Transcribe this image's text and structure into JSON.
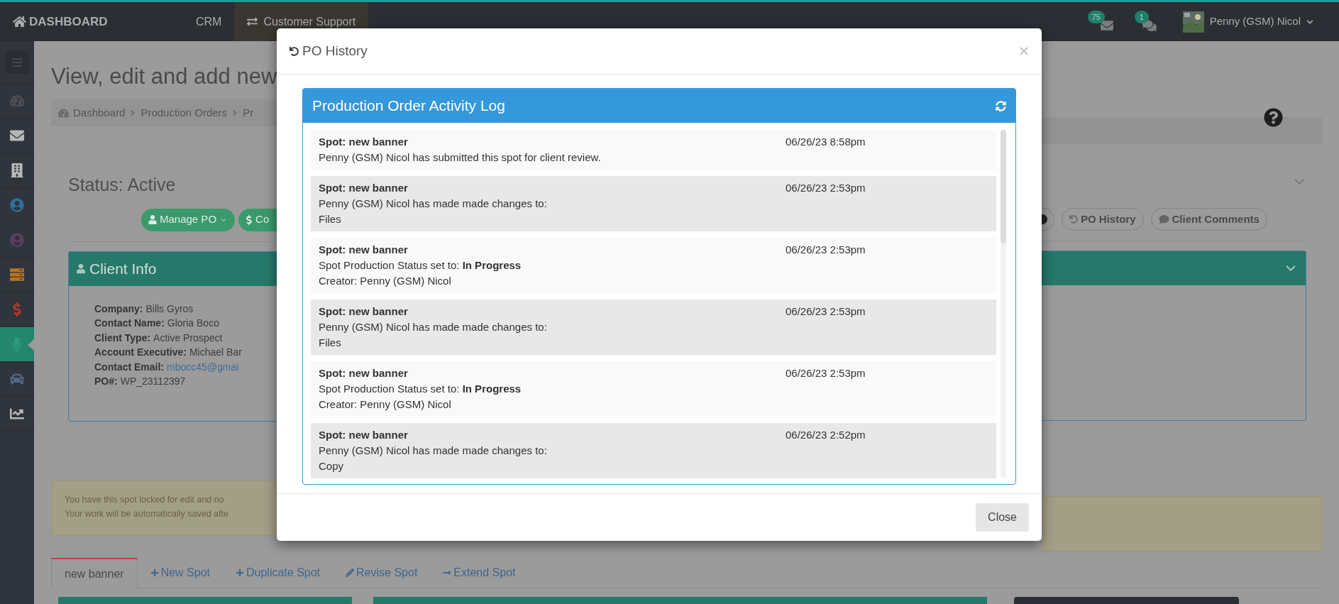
{
  "top_bar": {
    "brand": "DASHBOARD",
    "nav": [
      {
        "label": "CRM",
        "selected": false
      },
      {
        "label": "Customer Support",
        "selected": true
      }
    ],
    "mail_badge": "75",
    "chat_badge": "1",
    "user": "Penny (GSM) Nicol"
  },
  "sidebar": {
    "items": [
      {
        "kind": "dashboard",
        "selected": false
      },
      {
        "kind": "mail",
        "selected": false
      },
      {
        "kind": "building",
        "selected": false
      },
      {
        "kind": "contact",
        "selected": false
      },
      {
        "kind": "lead",
        "selected": false
      },
      {
        "kind": "server",
        "selected": false
      },
      {
        "kind": "dollar",
        "selected": false
      },
      {
        "kind": "microphone",
        "selected": true
      },
      {
        "kind": "car",
        "selected": false
      },
      {
        "kind": "chart",
        "selected": false
      }
    ]
  },
  "page": {
    "title": "View, edit and add new",
    "breadcrumb": [
      "Dashboard",
      "Production Orders",
      "Pr"
    ],
    "status": "Status: Active",
    "left_buttons": [
      {
        "label": "Manage PO",
        "kind": "manage"
      },
      {
        "label": "Co",
        "kind": "cost"
      }
    ],
    "right_buttons": [
      {
        "label": "PO History",
        "kind": "history"
      },
      {
        "label": "Client Comments",
        "kind": "comments"
      }
    ]
  },
  "client_info": {
    "title": "Client Info",
    "fields": [
      {
        "label": "Company:",
        "value": "Bills Gyros",
        "kind": "text"
      },
      {
        "label": "Contact Name:",
        "value": "Gloria Boco",
        "kind": "text"
      },
      {
        "label": "Client Type:",
        "value": "Active Prospect",
        "kind": "text"
      },
      {
        "label": "Account Executive:",
        "value": "Michael Bar",
        "kind": "text"
      },
      {
        "label": "Contact Email:",
        "value": "mbocc45@gmai",
        "kind": "link"
      },
      {
        "label": "PO#:",
        "value": "WP_23112397",
        "kind": "text"
      }
    ]
  },
  "alert": {
    "lines": [
      "You have this spot locked for edit and no",
      "Your work will be automatically saved afte"
    ]
  },
  "spot_tabs": [
    {
      "label": "new banner",
      "kind": "tab",
      "selected": true
    },
    {
      "label": "New Spot",
      "kind": "add",
      "selected": false
    },
    {
      "label": "Duplicate Spot",
      "kind": "add",
      "selected": false
    },
    {
      "label": "Revise Spot",
      "kind": "edit",
      "selected": false
    },
    {
      "label": "Extend Spot",
      "kind": "extend",
      "selected": false
    }
  ],
  "modal": {
    "title": "PO History",
    "log": {
      "title": "Production Order Activity Log",
      "entries": [
        {
          "title": "Spot: new banner",
          "time": "06/26/23 8:58pm",
          "lines": [
            "Penny (GSM) Nicol has submitted this spot for client review."
          ]
        },
        {
          "title": "Spot: new banner",
          "time": "06/26/23 2:53pm",
          "lines": [
            "Penny (GSM) Nicol has made made changes to:",
            "Files"
          ]
        },
        {
          "title": "Spot: new banner",
          "time": "06/26/23 2:53pm",
          "lines": [
            "Spot Production Status set to: **In Progress**",
            "Creator: Penny (GSM) Nicol"
          ]
        },
        {
          "title": "Spot: new banner",
          "time": "06/26/23 2:53pm",
          "lines": [
            "Penny (GSM) Nicol has made made changes to:",
            "Files"
          ]
        },
        {
          "title": "Spot: new banner",
          "time": "06/26/23 2:53pm",
          "lines": [
            "Spot Production Status set to: **In Progress**",
            "Creator: Penny (GSM) Nicol"
          ]
        },
        {
          "title": "Spot: new banner",
          "time": "06/26/23 2:52pm",
          "lines": [
            "Penny (GSM) Nicol has made made changes to:",
            "Copy"
          ]
        }
      ]
    },
    "close_button": "Close"
  }
}
